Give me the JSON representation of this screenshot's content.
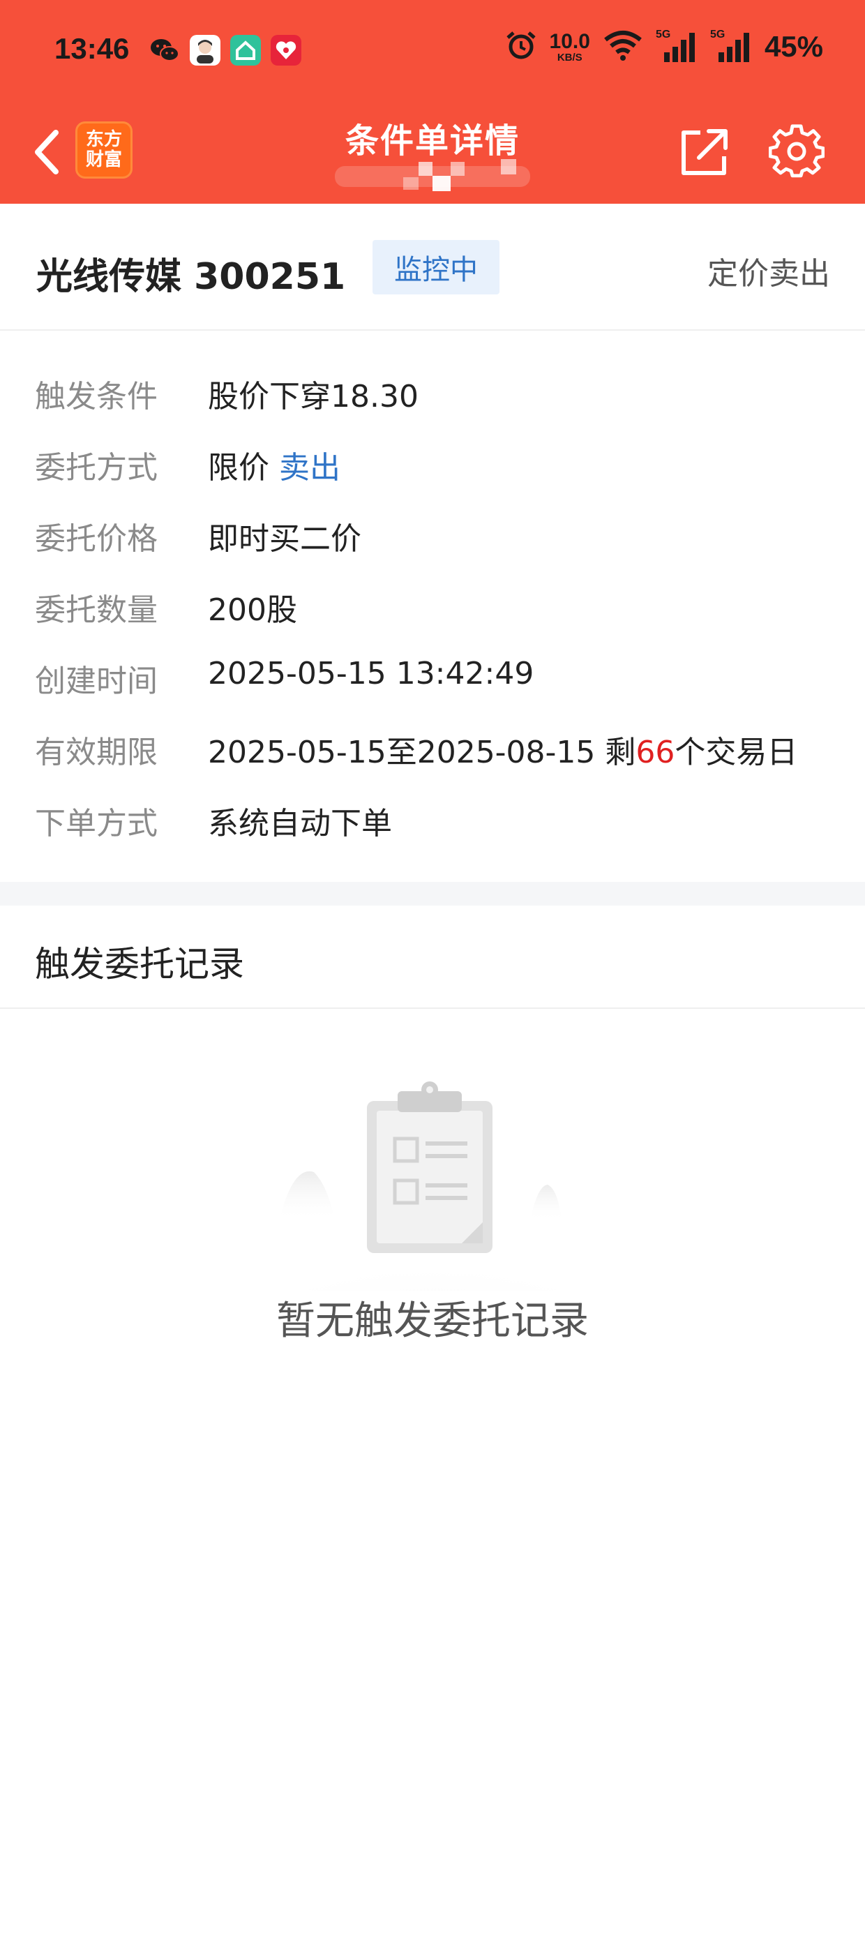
{
  "status_bar": {
    "time": "13:46",
    "net_speed_value": "10.0",
    "net_speed_unit": "KB/S",
    "signal_1_tag": "5G",
    "signal_2_tag": "5G",
    "battery": "45%",
    "apps": [
      {
        "icon": "wechat-icon",
        "color": "#1a1a1a"
      },
      {
        "icon": "avatar-app-icon",
        "color": "#ffffff"
      },
      {
        "icon": "house-app-icon",
        "color": "#2fc29b"
      },
      {
        "icon": "shopping-618-icon",
        "color": "#e7243a"
      }
    ]
  },
  "nav": {
    "title": "条件单详情",
    "brand_logo_line1": "东方",
    "brand_logo_line2": "财富"
  },
  "stock": {
    "name_code": "光线传媒 300251",
    "status_badge": "监控中",
    "order_type": "定价卖出"
  },
  "details": [
    {
      "label": "触发条件",
      "value": "股价下穿18.30"
    },
    {
      "label": "委托方式",
      "value_part1": "限价 ",
      "value_part2": "卖出"
    },
    {
      "label": "委托价格",
      "value": "即时买二价"
    },
    {
      "label": "委托数量",
      "value": "200股"
    },
    {
      "label": "创建时间",
      "value": "2025-05-15 13:42:49"
    },
    {
      "label": "有效期限",
      "value_part1": "2025-05-15至2025-08-15 剩",
      "value_part2": "66",
      "value_part3": "个交易日"
    },
    {
      "label": "下单方式",
      "value": "系统自动下单"
    }
  ],
  "records": {
    "title": "触发委托记录",
    "empty_text": "暂无触发委托记录"
  },
  "colors": {
    "header_bg": "#f6503a",
    "accent_blue": "#2f74c7",
    "badge_bg": "#e8f1fc",
    "highlight_red": "#e02020",
    "label_gray": "#8a8a8a"
  }
}
